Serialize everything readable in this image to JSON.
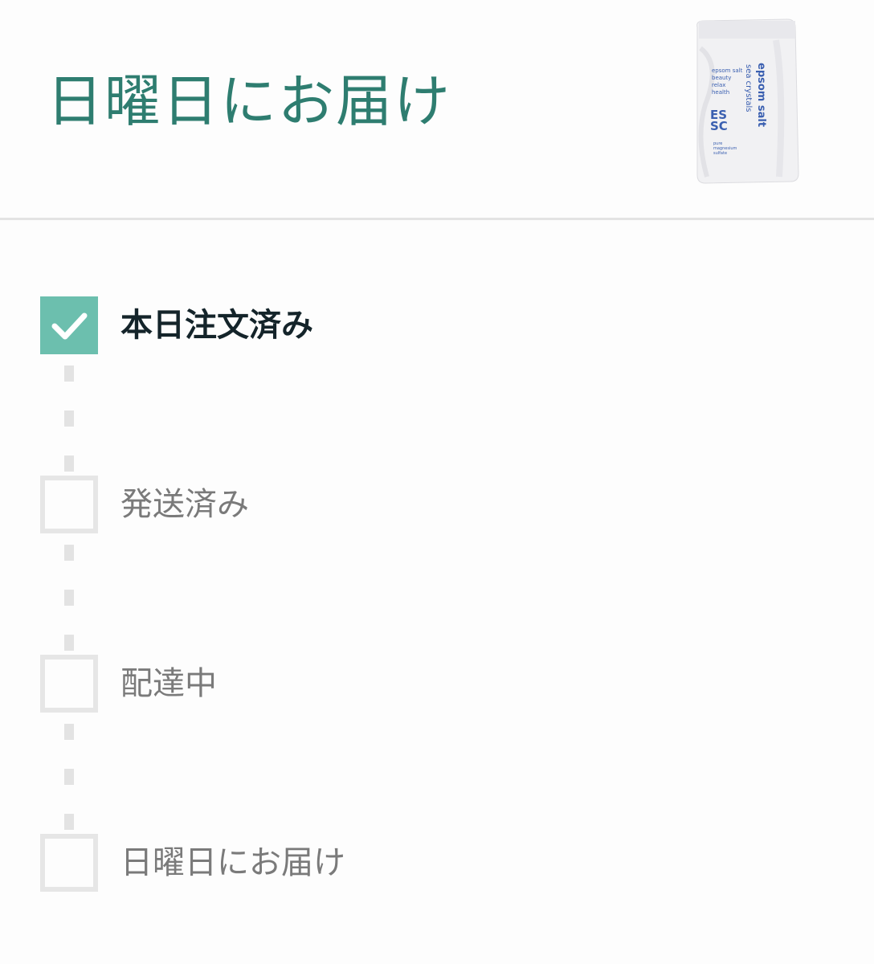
{
  "header": {
    "title": "日曜日にお届け",
    "product_image": {
      "label_lines": [
        "epsom salt",
        "sea crystals",
        "epsom salt",
        "beauty",
        "relax",
        "health",
        "ES",
        "SC",
        "pure",
        "magnesium",
        "sulfate"
      ]
    }
  },
  "tracker": {
    "steps": [
      {
        "label": "本日注文済み",
        "status": "done"
      },
      {
        "label": "発送済み",
        "status": "todo"
      },
      {
        "label": "配達中",
        "status": "todo"
      },
      {
        "label": "日曜日にお届け",
        "status": "todo"
      }
    ]
  },
  "colors": {
    "accent": "#2e7d70",
    "check_fill": "#6cbfae",
    "pending_border": "#e6e6e6",
    "connector": "#e3e3e3"
  },
  "icons": {
    "done": "checkmark-icon",
    "pending": "empty-checkbox-icon"
  }
}
